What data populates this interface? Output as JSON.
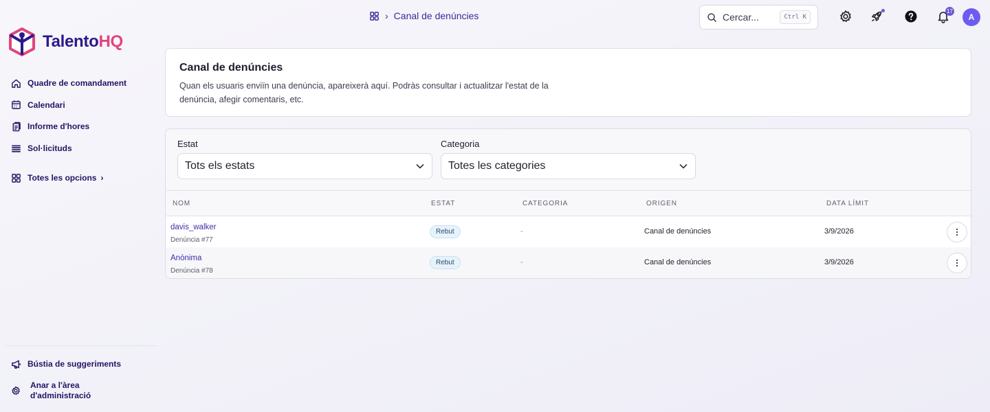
{
  "brand": {
    "name_part1": "Talento",
    "name_part2": "HQ",
    "colors": {
      "primary": "#2b1a8a",
      "accent": "#e0457b"
    }
  },
  "sidebar": {
    "items": [
      {
        "label": "Quadre de comandament",
        "icon": "home-icon"
      },
      {
        "label": "Calendari",
        "icon": "calendar-icon"
      },
      {
        "label": "Informe d'hores",
        "icon": "document-icon"
      },
      {
        "label": "Sol·licituds",
        "icon": "list-icon"
      }
    ],
    "more": {
      "label": "Totes les opcions",
      "icon": "grid-icon"
    },
    "bottom": {
      "suggestions": "Bústia de suggeriments",
      "admin_line1": "Anar a l'àrea",
      "admin_line2": "d'administració"
    }
  },
  "header": {
    "breadcrumb": "Canal de denúncies",
    "search": {
      "placeholder": "Cercar...",
      "shortcut": "Ctrl K"
    },
    "notifications_count": "17",
    "avatar_initial": "A"
  },
  "intro": {
    "title": "Canal de denúncies",
    "description": "Quan els usuaris enviïn una denúncia, apareixerà aquí. Podràs consultar i actualitzar l'estat de la denúncia, afegir comentaris, etc."
  },
  "filters": {
    "status": {
      "label": "Estat",
      "value": "Tots els estats"
    },
    "category": {
      "label": "Categoria",
      "value": "Totes les categories"
    }
  },
  "table": {
    "columns": [
      "NOM",
      "ESTAT",
      "CATEGORIA",
      "ORIGEN",
      "DATA LÍMIT"
    ],
    "rows": [
      {
        "name": "davis_walker",
        "sub": "Denúncia #77",
        "status": "Rebut",
        "category": "-",
        "origin": "Canal de denúncies",
        "deadline": "3/9/2026"
      },
      {
        "name": "Anònima",
        "sub": "Denúncia #78",
        "status": "Rebut",
        "category": "-",
        "origin": "Canal de denúncies",
        "deadline": "3/9/2026"
      }
    ]
  }
}
